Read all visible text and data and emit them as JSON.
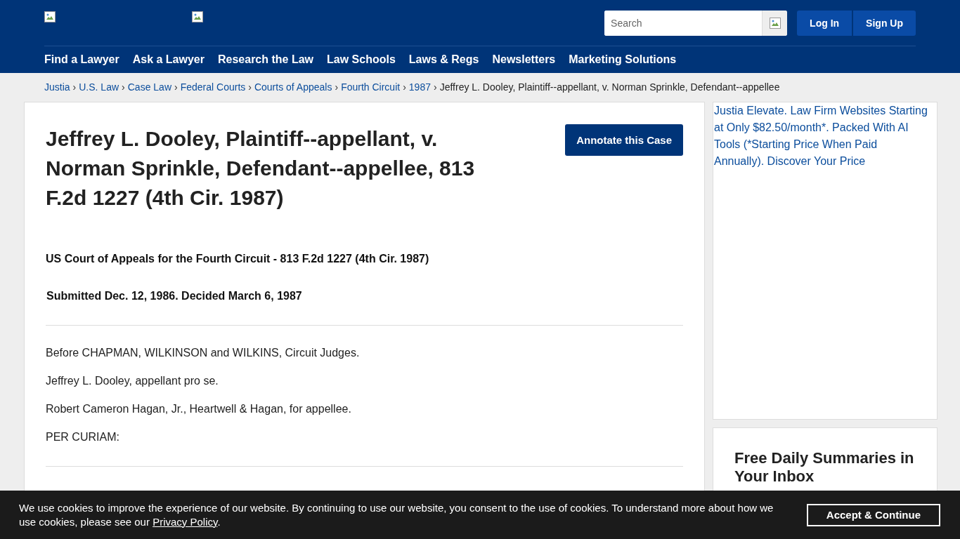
{
  "header": {
    "search": {
      "placeholder": "Search"
    },
    "buttons": [
      "Log In",
      "Sign Up"
    ],
    "nav": [
      "Find a Lawyer",
      "Ask a Lawyer",
      "Research the Law",
      "Law Schools",
      "Laws & Regs",
      "Newsletters",
      "Marketing Solutions"
    ]
  },
  "breadcrumb": {
    "links": [
      "Justia",
      "U.S. Law",
      "Case Law",
      "Federal Courts",
      "Courts of Appeals",
      "Fourth Circuit",
      "1987"
    ],
    "separator": "›",
    "current": "Jeffrey L. Dooley, Plaintiff--appellant, v. Norman Sprinkle, Defendant--appellee"
  },
  "case": {
    "title": "Jeffrey L. Dooley, Plaintiff--appellant, v. Norman Sprinkle, Defendant--appellee, 813 F.2d 1227 (4th Cir. 1987)",
    "annotate_button": "Annotate this Case",
    "court": "US Court of Appeals for the Fourth Circuit - 813 F.2d 1227 (4th Cir. 1987)",
    "dates": "Submitted Dec. 12, 1986. Decided March 6, 1987",
    "paragraphs": [
      "Before CHAPMAN, WILKINSON and WILKINS, Circuit Judges.",
      "Jeffrey L. Dooley, appellant pro se.",
      "Robert Cameron Hagan, Jr., Heartwell & Hagan, for appellee.",
      "PER CURIAM:"
    ]
  },
  "sidebar": {
    "ad_alt": "Justia Elevate. Law Firm Websites Starting at Only $82.50/month*. Packed With AI Tools (*Starting Price When Paid Annually). Discover Your Price",
    "newsletter_title": "Free Daily Summaries in Your Inbox"
  },
  "cookie_bar": {
    "text_before": "We use cookies to improve the experience of our website. By continuing to use our website, you consent to the use of cookies. To understand more about how we use cookies, please see our ",
    "link": "Privacy Policy",
    "text_after": ".",
    "button": "Accept & Continue"
  }
}
